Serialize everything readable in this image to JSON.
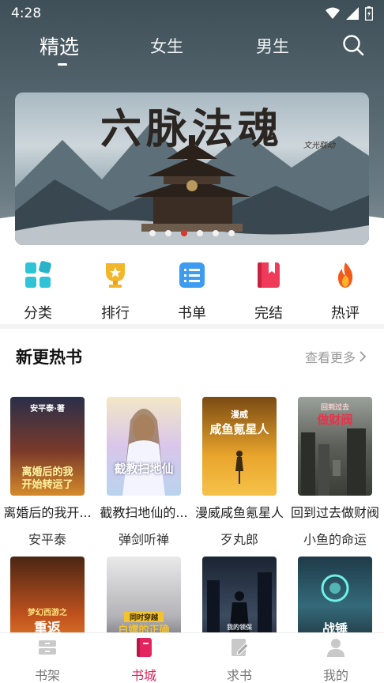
{
  "status": {
    "time": "4:28",
    "icons": [
      "wifi-icon",
      "signal-icon",
      "battery-icon"
    ]
  },
  "top_tabs": [
    {
      "label": "精选",
      "active": true
    },
    {
      "label": "女生",
      "active": false
    },
    {
      "label": "男生",
      "active": false
    }
  ],
  "banner": {
    "title": "六脉法魂",
    "subtitle": "文光联动",
    "slide_count": 6,
    "active_slide": 3
  },
  "categories": [
    {
      "label": "分类",
      "icon": "grid-icon",
      "color": "#2ec4d6"
    },
    {
      "label": "排行",
      "icon": "trophy-icon",
      "color": "#f2b62b"
    },
    {
      "label": "书单",
      "icon": "list-icon",
      "color": "#3d9bf0"
    },
    {
      "label": "完结",
      "icon": "bookmark-book-icon",
      "color": "#f03a5a"
    },
    {
      "label": "热评",
      "icon": "flame-icon",
      "color": "#f25a1c"
    }
  ],
  "section": {
    "title": "新更热书",
    "more": "查看更多"
  },
  "books_row1": [
    {
      "title": "离婚后的我开...",
      "author": "安平泰",
      "cover_text": "离婚后的我\n开始转运了",
      "cover_top": "安平泰·著"
    },
    {
      "title": "截教扫地仙的...",
      "author": "弹剑听禅",
      "cover_text": "截教扫地仙",
      "cover_top": ""
    },
    {
      "title": "漫威咸鱼氪星人",
      "author": "歹丸郎",
      "cover_text": "咸鱼氪星人",
      "cover_top": "漫威"
    },
    {
      "title": "回到过去做财阀",
      "author": "小鱼的命运",
      "cover_text": "做财阀",
      "cover_top": "回到过去"
    }
  ],
  "books_row2": [
    {
      "cover_text": "重返",
      "cover_top": "梦幻西游之"
    },
    {
      "cover_text": "白嫖的正确",
      "cover_top": "同时穿越"
    },
    {
      "cover_text": "我的领保",
      "cover_top": ""
    },
    {
      "cover_text": "战锤",
      "cover_top": ""
    }
  ],
  "bottom_nav": [
    {
      "label": "书架",
      "active": false
    },
    {
      "label": "书城",
      "active": true
    },
    {
      "label": "求书",
      "active": false
    },
    {
      "label": "我的",
      "active": false
    }
  ],
  "colors": {
    "accent": "#e3245e",
    "banner_dot_active": "#d33a2f"
  }
}
